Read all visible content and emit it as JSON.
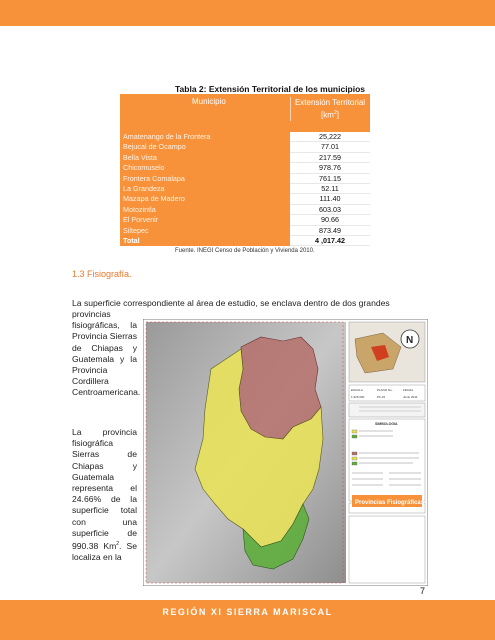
{
  "table": {
    "title": "Tabla 2: Extensión Territorial de los municipios",
    "col_municipio": "Municipio",
    "col_extension": "Extensión Territorial",
    "col_unit": "[km",
    "rows": [
      {
        "name": "Amatenango de la Frontera",
        "value": "25,222"
      },
      {
        "name": "Bejucal de Ocampo",
        "value": "77.01"
      },
      {
        "name": "Bella Vista",
        "value": "217.59"
      },
      {
        "name": "Chicomuselo",
        "value": "978.76"
      },
      {
        "name": "Frontera Comalapa",
        "value": "761.15"
      },
      {
        "name": "La Grandeza",
        "value": "52.11"
      },
      {
        "name": "Mazapa de Madero",
        "value": "111.40"
      },
      {
        "name": "Motozintla",
        "value": "603.03"
      },
      {
        "name": "El Porvenir",
        "value": "90.66"
      },
      {
        "name": "Siltepec",
        "value": "873.49"
      }
    ],
    "total_label": "Total",
    "total_value": "4 ,017.42",
    "source": "Fuente. INEGI Censo de Población y Vivienda 2010."
  },
  "section": {
    "title": "1.3 Fisiografía.",
    "intro": "La superficie correspondiente al área de estudio, se enclava dentro de dos grandes",
    "col_p1": "provincias fisiográficas, la Provincia Sierras de Chiapas y Guatemala y la Provincia Cordillera Centroamericana.",
    "col_p2_a": "La provincia fisiográfica Sierras de Chiapas y Guatemala representa el 24.66% de la superficie total con una superficie de 990.38 Km",
    "col_p2_b": ". Se localiza en la"
  },
  "map": {
    "label_provincias": "Provincias Fisiográficas",
    "legend_title": "SIMBOLOGIA",
    "scale_label": "ESCALA",
    "scale_value": "1:325 000",
    "plano_label": "PLANO No.",
    "plano_value": "PF-01",
    "fecha_label": "FECHA",
    "fecha_value": "Junio 2011"
  },
  "page": {
    "number": "7",
    "footer": "REGIÓN XI SIERRA MARISCAL"
  },
  "colors": {
    "accent": "#f7923a",
    "section": "#e6782a",
    "region_yellow": "#e8e25a",
    "region_green": "#5fae3e",
    "region_red": "#b5706a"
  }
}
